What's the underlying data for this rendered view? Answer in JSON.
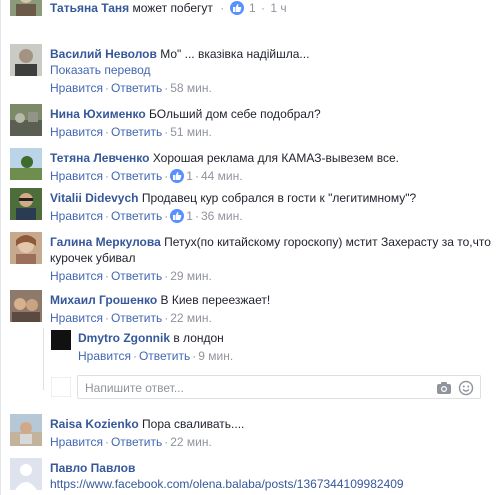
{
  "colors": {
    "author": "#365899",
    "link": "#4267b2",
    "meta": "#90949c",
    "text": "#1d2129",
    "like": "#5890ff"
  },
  "icons": {
    "like": "thumbs-up-icon",
    "camera": "camera-icon",
    "emoji": "smiley-icon"
  },
  "comments": [
    {
      "author": "Татьяна Таня",
      "text": "может побегут",
      "actions": {
        "like": "Нравится",
        "reply": "Ответить",
        "likes": "1",
        "time": "1 ч"
      }
    },
    {
      "author": "Василий Неволов",
      "text": "Мо\" ... вказівка надійшла...",
      "translate": "Показать перевод",
      "actions": {
        "like": "Нравится",
        "reply": "Ответить",
        "time": "58 мин."
      }
    },
    {
      "author": "Нина Юхименко",
      "text": "БОльший дом себе подобрал?",
      "actions": {
        "like": "Нравится",
        "reply": "Ответить",
        "time": "51 мин."
      }
    },
    {
      "author": "Тетяна Левченко",
      "text": "Хорошая реклама для КАМАЗ-вывезем все.",
      "actions": {
        "like": "Нравится",
        "reply": "Ответить",
        "likes": "1",
        "time": "44 мин."
      }
    },
    {
      "author": "Vitalii Didevych",
      "text": "Продавец кур собрался в гости к \"легитимному\"?",
      "actions": {
        "like": "Нравится",
        "reply": "Ответить",
        "likes": "1",
        "time": "36 мин."
      }
    },
    {
      "author": "Галина Меркулова",
      "text": "Петух(по китайскому гороскопу) мстит Захерасту за то,что курочек убивал",
      "actions": {
        "like": "Нравится",
        "reply": "Ответить",
        "time": "29 мин."
      }
    },
    {
      "author": "Михаил Грошенко",
      "text": "В Киев переезжает!",
      "actions": {
        "like": "Нравится",
        "reply": "Ответить",
        "time": "22 мин."
      }
    },
    {
      "author": "Dmytro Zgonnik",
      "text": "в лондон",
      "actions": {
        "like": "Нравится",
        "reply": "Ответить",
        "time": "9 мин."
      }
    },
    {
      "author": "Raisa Kozienko",
      "text": "Пора сваливать....",
      "actions": {
        "like": "Нравится",
        "reply": "Ответить",
        "time": "22 мин."
      }
    },
    {
      "author": "Павло Павлов",
      "text": "https://www.facebook.com/olena.balaba/posts/1367344109982409"
    }
  ],
  "reply_box": {
    "placeholder": "Напишите ответ..."
  }
}
